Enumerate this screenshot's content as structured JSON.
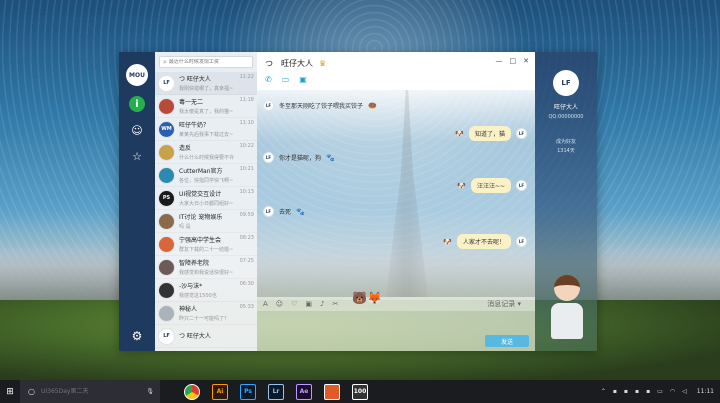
{
  "window": {
    "title": "旺仔大人",
    "title_prefix": "つ",
    "controls": [
      "—",
      "□",
      "✕"
    ]
  },
  "rail": {
    "avatar_text": "MOU",
    "chat_icon": "i"
  },
  "search": {
    "placeholder": "最近什么时候发现工资"
  },
  "contacts": [
    {
      "name": "つ  旺仔大人",
      "time": "11:22",
      "msg": "我刚快错哪了，真幸福~",
      "av": "LF",
      "color": "#ffffff",
      "text": "#1f3a5f",
      "selected": true
    },
    {
      "name": "毒一无二",
      "time": "11:18",
      "msg": "我太傻是真了，我的猫~",
      "av": "",
      "color": "#b94a3a"
    },
    {
      "name": "旺仔牛奶？",
      "time": "11:10",
      "msg": "某某先后我事下载过去~",
      "av": "WM",
      "color": "#2a5fb0"
    },
    {
      "name": "造反",
      "time": "10:22",
      "msg": "什么什么时候我得要不许",
      "av": "",
      "color": "#c8a248"
    },
    {
      "name": "CutterMan官方",
      "time": "10:21",
      "msg": "各位，快指同学快飞啊~",
      "av": "",
      "color": "#2a8ab0"
    },
    {
      "name": "UI视觉交互设计",
      "time": "10:13",
      "msg": "大家大日小日都同组好~",
      "av": "PS",
      "color": "#1a1a1a"
    },
    {
      "name": "IT讨论 宠物娱乐",
      "time": "09:59",
      "msg": "吗 是",
      "av": "",
      "color": "#8a6a4a"
    },
    {
      "name": "宁强高中学生会",
      "time": "08:23",
      "msg": "群友下载的二十一结婚~",
      "av": "",
      "color": "#d9653a"
    },
    {
      "name": "智障养老院",
      "time": "07:25",
      "msg": "我感觉和我说话快很好~",
      "av": "",
      "color": "#6b5a55"
    },
    {
      "name": "-沙与沫*",
      "time": "06:30",
      "msg": "我感觉这1500也",
      "av": "",
      "color": "#333333"
    },
    {
      "name": "神秘人",
      "time": "05:33",
      "msg": "昨只二十一可能吗了？",
      "av": "",
      "color": "#aab2ba"
    },
    {
      "name": "つ  旺仔大人",
      "time": "",
      "msg": "",
      "av": "LF",
      "color": "#ffffff",
      "text": "#1f3a5f"
    }
  ],
  "messages": [
    {
      "side": "left",
      "text": "冬至那天刚吃了饺子喂我买饺子",
      "emoji": "🍩"
    },
    {
      "side": "right",
      "text": "知道了，猫",
      "emoji": "🐶"
    },
    {
      "side": "left",
      "text": "你才是猫呢，狗",
      "emoji": "🐾"
    },
    {
      "side": "right",
      "text": "汪汪汪~~",
      "emoji": "🐶"
    },
    {
      "side": "left",
      "text": "去死",
      "emoji": "🐾"
    },
    {
      "side": "right",
      "text": "人家才不去呢！",
      "emoji": "🐶"
    }
  ],
  "sender_avatar": "LF",
  "toolbar": {
    "icons": [
      "A",
      "☺",
      "♡",
      "▣",
      "♪",
      "✂"
    ],
    "history": "消息记录 ▾"
  },
  "send_label": "发送",
  "profile": {
    "avatar": "LF",
    "name": "旺仔大人",
    "qq": "QQ:00000000",
    "stat_label": "成为好友",
    "stat_days": "1314天"
  },
  "taskbar": {
    "search_placeholder": "UI365Day第二天",
    "apps": [
      {
        "label": "",
        "name": "chrome-icon",
        "bg": "#e8b030",
        "fg": "#fff"
      },
      {
        "label": "Ai",
        "name": "illustrator-icon",
        "bg": "#2b1a0a",
        "fg": "#ff9a00"
      },
      {
        "label": "Ps",
        "name": "photoshop-icon",
        "bg": "#0a1a2b",
        "fg": "#31a8ff"
      },
      {
        "label": "Lr",
        "name": "lightroom-icon",
        "bg": "#0a1a2b",
        "fg": "#9bc3e8"
      },
      {
        "label": "Ae",
        "name": "aftereffects-icon",
        "bg": "#1a0a2b",
        "fg": "#c09bff"
      },
      {
        "label": "",
        "name": "qq-icon",
        "bg": "#e05a2a",
        "fg": "#fff"
      },
      {
        "label": "100",
        "name": "app-100-icon",
        "bg": "#333",
        "fg": "#fff"
      }
    ],
    "clock": "11:11"
  }
}
